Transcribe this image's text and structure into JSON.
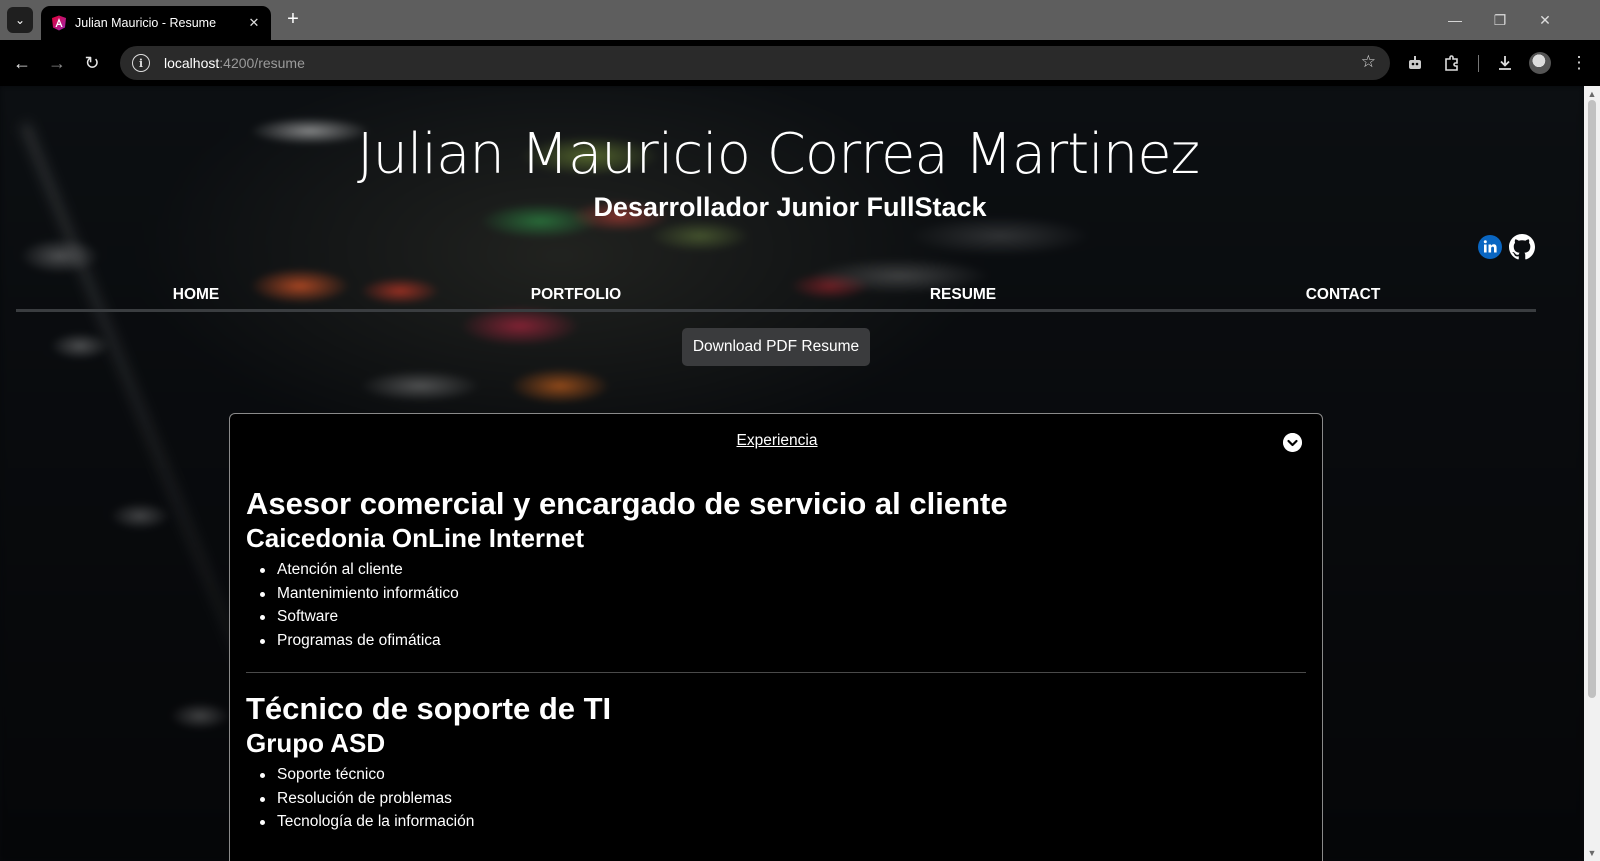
{
  "browser": {
    "tab_title": "Julian Mauricio - Resume",
    "url_host": "localhost",
    "url_path": ":4200/resume"
  },
  "header": {
    "name": "Julian Mauricio Correa Martinez",
    "role": "Desarrollador Junior FullStack"
  },
  "social": [
    {
      "icon": "linkedin-icon",
      "color": "#0a66c2"
    },
    {
      "icon": "github-icon",
      "color": "#ffffff"
    }
  ],
  "nav": {
    "home": "HOME",
    "portfolio": "PORTFOLIO",
    "resume": "RESUME",
    "contact": "CONTACT"
  },
  "download_button": "Download PDF Resume",
  "experience": {
    "heading": "Experiencia",
    "jobs": [
      {
        "title": "Asesor comercial y encargado de servicio al cliente",
        "company": "Caicedonia OnLine Internet",
        "items": [
          "Atención al cliente",
          "Mantenimiento informático",
          "Software",
          "Programas de ofimática"
        ]
      },
      {
        "title": "Técnico de soporte de TI",
        "company": "Grupo ASD",
        "items": [
          "Soporte técnico",
          "Resolución de problemas",
          "Tecnología de la información"
        ]
      }
    ]
  }
}
